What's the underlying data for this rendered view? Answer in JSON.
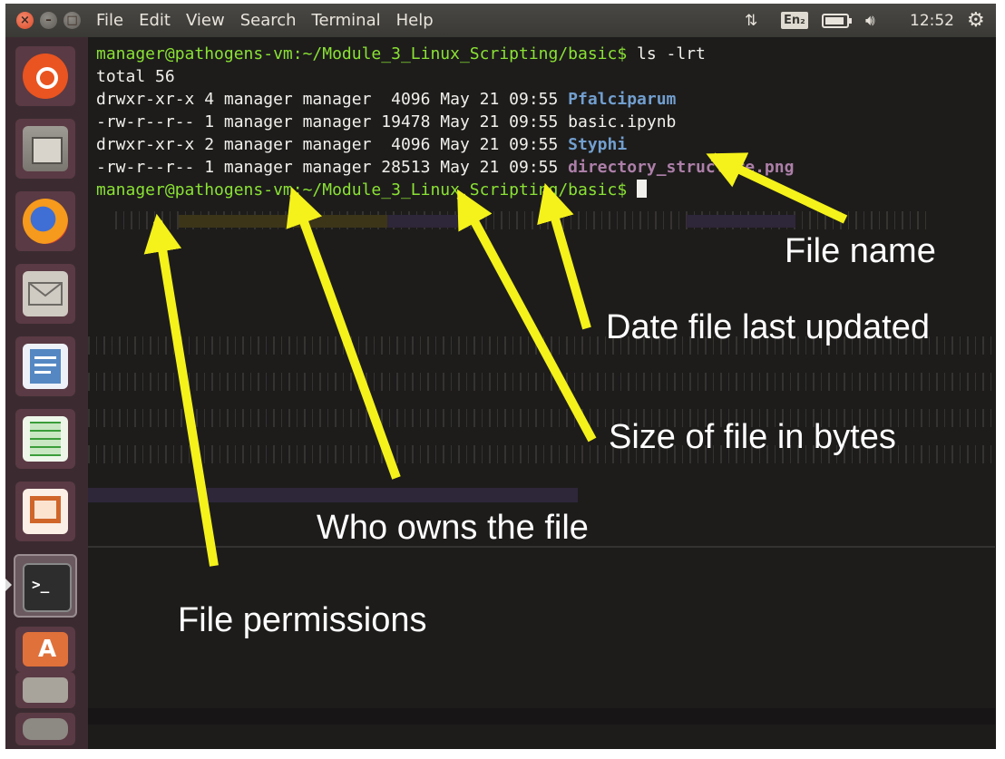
{
  "menubar": {
    "items": [
      "File",
      "Edit",
      "View",
      "Search",
      "Terminal",
      "Help"
    ],
    "keyboard_layout": "En₂",
    "clock": "12:52"
  },
  "launcher": {
    "items": [
      {
        "icon": "ubuntu-dash-icon"
      },
      {
        "icon": "files-icon"
      },
      {
        "icon": "firefox-icon"
      },
      {
        "icon": "mail-icon"
      },
      {
        "icon": "writer-icon"
      },
      {
        "icon": "calc-icon"
      },
      {
        "icon": "impress-icon"
      },
      {
        "icon": "terminal-icon"
      },
      {
        "icon": "software-center-icon"
      },
      {
        "icon": "settings-icon"
      },
      {
        "icon": "trash-icon"
      }
    ]
  },
  "terminal": {
    "prompt": "manager@pathogens-vm:~/Module_3_Linux_Scripting/basic$",
    "command": " ls -lrt",
    "total": "total 56",
    "entries": [
      {
        "meta": "drwxr-xr-x 4 manager manager  4096 May 21 09:55 ",
        "name": "Pfalciparum",
        "kind": "dir"
      },
      {
        "meta": "-rw-r--r-- 1 manager manager 19478 May 21 09:55 ",
        "name": "basic.ipynb",
        "kind": "file"
      },
      {
        "meta": "drwxr-xr-x 2 manager manager  4096 May 21 09:55 ",
        "name": "Styphi",
        "kind": "dir"
      },
      {
        "meta": "-rw-r--r-- 1 manager manager 28513 May 21 09:55 ",
        "name": "directory_structure.png",
        "kind": "image"
      }
    ],
    "prompt2": "manager@pathogens-vm:~/Module_3_Linux_Scripting/basic$"
  },
  "annotations": {
    "file_name": "File name",
    "date": "Date file last updated",
    "size": "Size of file in bytes",
    "owner": "Who owns the file",
    "permissions": "File permissions"
  },
  "colors": {
    "prompt": "#8ae234",
    "directory": "#729fcf",
    "image_file": "#ad7fa8",
    "arrow": "#f4f21a"
  }
}
